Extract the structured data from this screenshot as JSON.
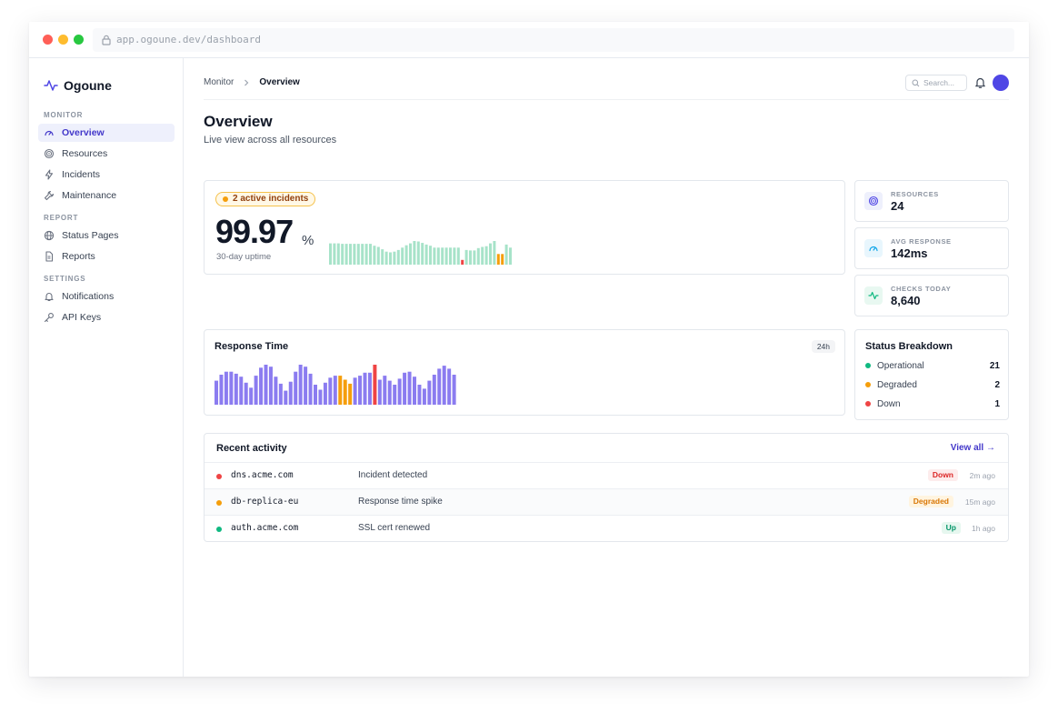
{
  "browser": {
    "url": "app.ogoune.dev/dashboard"
  },
  "sidebar": {
    "brand": "Ogoune",
    "sections": [
      {
        "label": "MONITOR",
        "items": [
          {
            "label": "Overview",
            "icon": "gauge-icon",
            "active": true
          },
          {
            "label": "Resources",
            "icon": "target-icon"
          },
          {
            "label": "Incidents",
            "icon": "bolt-icon"
          },
          {
            "label": "Maintenance",
            "icon": "wrench-icon"
          }
        ]
      },
      {
        "label": "REPORT",
        "items": [
          {
            "label": "Status Pages",
            "icon": "globe-icon"
          },
          {
            "label": "Reports",
            "icon": "document-icon"
          }
        ]
      },
      {
        "label": "SETTINGS",
        "items": [
          {
            "label": "Notifications",
            "icon": "bell-icon"
          },
          {
            "label": "API Keys",
            "icon": "key-icon"
          }
        ]
      }
    ]
  },
  "header": {
    "breadcrumb": [
      "Monitor",
      "Overview"
    ],
    "search_placeholder": "Search..."
  },
  "page": {
    "title": "Overview",
    "subtitle": "Live view across all resources"
  },
  "uptime": {
    "incidents_label": "2 active incidents",
    "value": "99.97",
    "unit": "%",
    "label": "30-day uptime",
    "history": [
      1,
      1,
      1,
      1,
      1,
      1,
      1,
      1,
      1,
      1,
      1,
      1,
      1,
      1,
      1,
      1,
      1,
      1,
      1,
      1,
      1,
      1,
      1,
      1,
      1,
      1,
      1,
      1,
      1,
      1,
      1,
      1,
      1,
      1,
      1,
      1,
      1,
      3,
      1,
      1,
      1,
      1,
      1,
      1,
      1,
      1,
      2,
      2,
      1,
      1
    ],
    "bar_levels": [
      0.9,
      0.9,
      0.9,
      0.88,
      0.88,
      0.88,
      0.88,
      0.88,
      0.88,
      0.88,
      0.88,
      0.8,
      0.75,
      0.65,
      0.55,
      0.52,
      0.55,
      0.62,
      0.72,
      0.82,
      0.9,
      1.0,
      0.98,
      0.92,
      0.85,
      0.8,
      0.72,
      0.72,
      0.72,
      0.72,
      0.72,
      0.72,
      0.72,
      0.2,
      0.62,
      0.6,
      0.6,
      0.7,
      0.75,
      0.78,
      0.9,
      1.0,
      0.45,
      0.45,
      0.85,
      0.72
    ]
  },
  "stats": [
    {
      "label": "RESOURCES",
      "value": "24",
      "icon": "target-icon",
      "color": "#4f46e5",
      "bg": "#eef0fc"
    },
    {
      "label": "AVG RESPONSE",
      "value": "142ms",
      "icon": "gauge-icon",
      "color": "#0ea5e9",
      "bg": "#e8f6fd"
    },
    {
      "label": "CHECKS TODAY",
      "value": "8,640",
      "icon": "activity-icon",
      "color": "#10b981",
      "bg": "#e8f8f1"
    }
  ],
  "response_time": {
    "title": "Response Time",
    "range": "24h"
  },
  "chart_data": {
    "type": "bar",
    "title": "Response Time",
    "values": [
      48,
      60,
      66,
      66,
      62,
      56,
      44,
      34,
      58,
      74,
      80,
      76,
      56,
      42,
      28,
      46,
      66,
      80,
      76,
      62,
      40,
      30,
      44,
      54,
      58,
      58,
      50,
      42,
      54,
      58,
      64,
      64,
      80,
      50,
      58,
      48,
      40,
      52,
      64,
      66,
      56,
      40,
      32,
      48,
      60,
      72,
      78,
      72,
      60
    ],
    "status": [
      0,
      0,
      0,
      0,
      0,
      0,
      0,
      0,
      0,
      0,
      0,
      0,
      0,
      0,
      0,
      0,
      0,
      0,
      0,
      0,
      0,
      0,
      0,
      0,
      0,
      1,
      1,
      1,
      0,
      0,
      0,
      0,
      2,
      0,
      0,
      0,
      0,
      0,
      0,
      0,
      0,
      0,
      0,
      0,
      0,
      0,
      0,
      0,
      0
    ],
    "ylim": [
      0,
      80
    ]
  },
  "status_breakdown": {
    "title": "Status Breakdown",
    "rows": [
      {
        "label": "Operational",
        "count": "21",
        "color": "#10b981"
      },
      {
        "label": "Degraded",
        "count": "2",
        "color": "#f59e0b"
      },
      {
        "label": "Down",
        "count": "1",
        "color": "#ef4444"
      }
    ]
  },
  "activity": {
    "title": "Recent activity",
    "view_all": "View all →",
    "rows": [
      {
        "host": "dns.acme.com",
        "event": "Incident detected",
        "status": "Down",
        "time": "2m ago",
        "dot": "#ef4444",
        "badge_bg": "#fdecec",
        "badge_fg": "#dc2626"
      },
      {
        "host": "db-replica-eu",
        "event": "Response time spike",
        "status": "Degraded",
        "time": "15m ago",
        "dot": "#f59e0b",
        "badge_bg": "#fff4e0",
        "badge_fg": "#d97706"
      },
      {
        "host": "auth.acme.com",
        "event": "SSL cert renewed",
        "status": "Up",
        "time": "1h ago",
        "dot": "#10b981",
        "badge_bg": "#e6f7ef",
        "badge_fg": "#059669"
      }
    ]
  },
  "colors": {
    "accent": "#4f46e5",
    "bar_ok": "#a7e3c9",
    "bar_down": "#ef4444",
    "bar_warn": "#f59e0b",
    "resp_bar": "#8b7cf0"
  }
}
